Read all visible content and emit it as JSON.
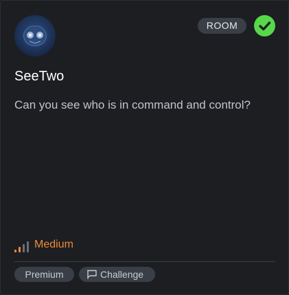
{
  "card": {
    "type_badge": "ROOM",
    "status_icon": "check-circle-icon",
    "title": "SeeTwo",
    "description": "Can you see who is in command and control?",
    "difficulty": {
      "label": "Medium",
      "level": 2,
      "max_level": 4,
      "color": "#f08a37"
    },
    "tags": [
      {
        "label": "Premium"
      },
      {
        "label": "Challenge",
        "icon": "flag-icon"
      }
    ]
  },
  "colors": {
    "background": "#1c1e22",
    "badge_bg": "#3a3f47",
    "completed_green": "#56d84a",
    "difficulty_inactive": "#6b7078"
  }
}
